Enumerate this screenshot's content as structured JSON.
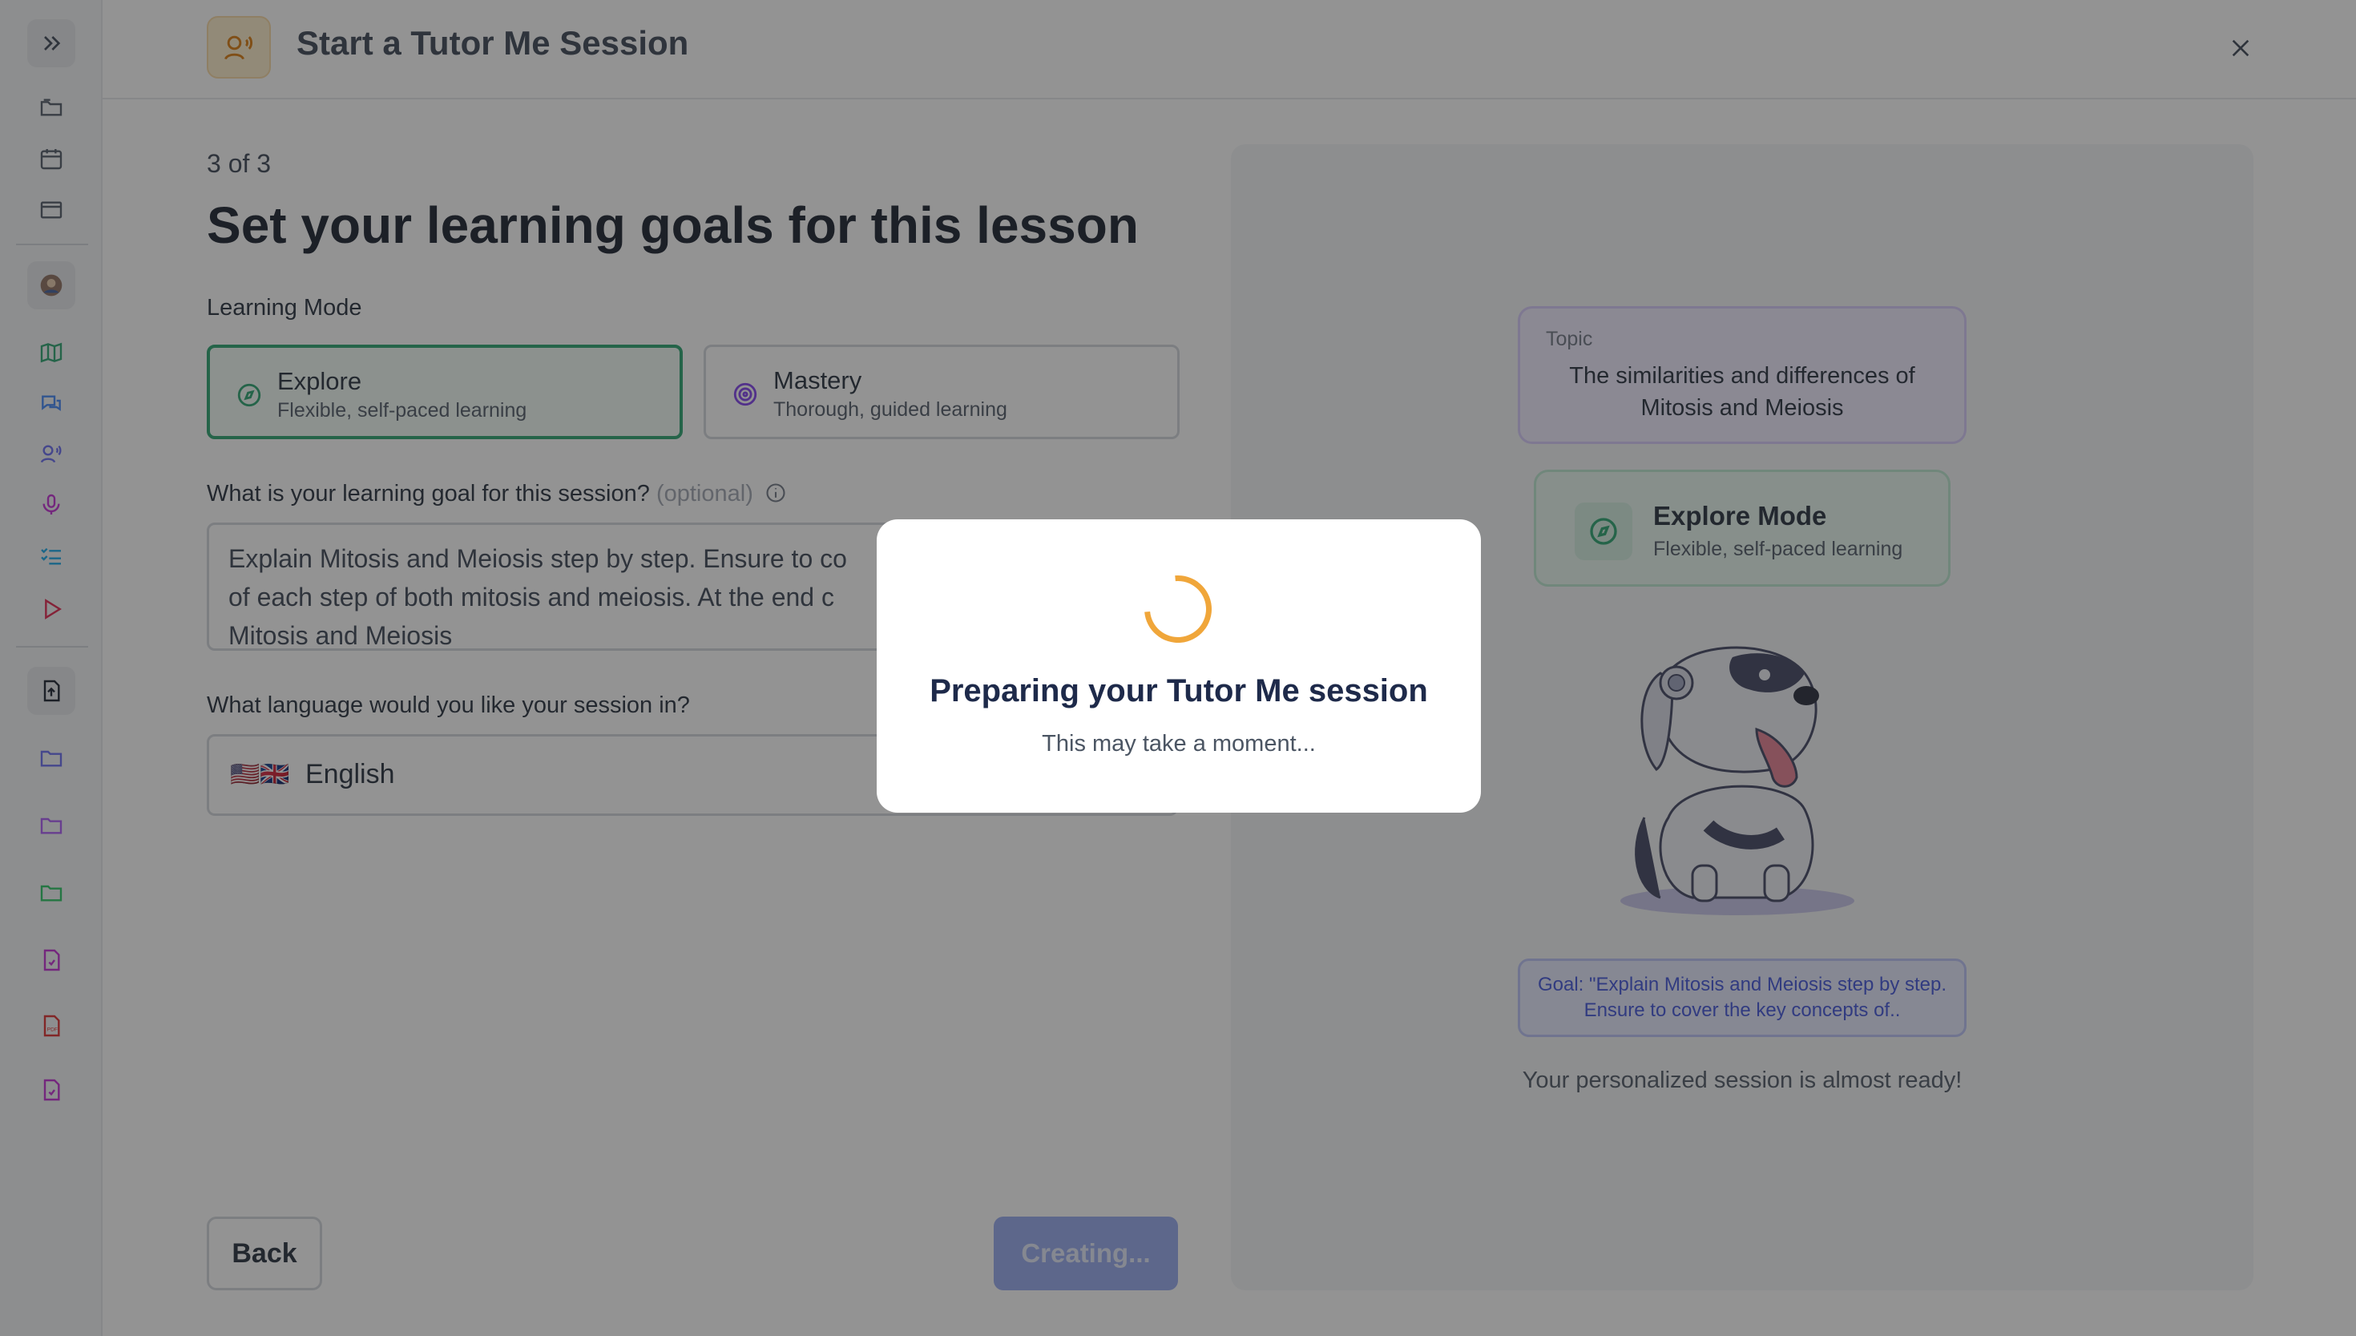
{
  "header": {
    "title": "Start a Tutor Me Session"
  },
  "form": {
    "step": "3 of 3",
    "heading": "Set your learning goals for this lesson",
    "mode_label": "Learning Mode",
    "modes": [
      {
        "title": "Explore",
        "subtitle": "Flexible, self-paced learning",
        "selected": true
      },
      {
        "title": "Mastery",
        "subtitle": "Thorough, guided learning",
        "selected": false
      }
    ],
    "goal_label": "What is your learning goal for this session?",
    "goal_optional": "(optional)",
    "goal_value": "Explain Mitosis and Meiosis step by step. Ensure to co... of each step of both mitosis and meiosis. At the end c... Mitosis and Meiosis",
    "goal_lines": [
      "Explain Mitosis and Meiosis step by step. Ensure to co",
      "of each step of both mitosis and meiosis. At the end c",
      "Mitosis and Meiosis"
    ],
    "language_label": "What language would you like your session in?",
    "language_flags": "🇺🇸🇬🇧",
    "language_value": "English",
    "back_label": "Back",
    "create_label": "Creating..."
  },
  "preview": {
    "topic_label": "Topic",
    "topic_text": "The similarities and differences of Mitosis and Meiosis",
    "mode_title": "Explore Mode",
    "mode_subtitle": "Flexible, self-paced learning",
    "goal_text": "Goal: \"Explain Mitosis and Meiosis step by step. Ensure to cover the key concepts of..",
    "ready_text": "Your personalized session is almost ready!"
  },
  "modal": {
    "title": "Preparing your Tutor Me session",
    "subtitle": "This may take a moment..."
  },
  "sidebar": {
    "icons": [
      "chevron-double-right-icon",
      "folder-icon",
      "calendar-icon",
      "window-icon",
      "avatar",
      "map-icon",
      "chat-icon",
      "tutor-voice-icon",
      "microphone-icon",
      "checklist-icon",
      "play-icon",
      "upload-icon",
      "folder-icon",
      "folder-icon",
      "folder-icon",
      "file-icon",
      "pdf-icon",
      "file-icon"
    ]
  },
  "colors": {
    "accent_green": "#22a06b",
    "accent_orange": "#f0a63a",
    "button_blue": "#93a6ee",
    "purple": "#8b5cf6"
  }
}
